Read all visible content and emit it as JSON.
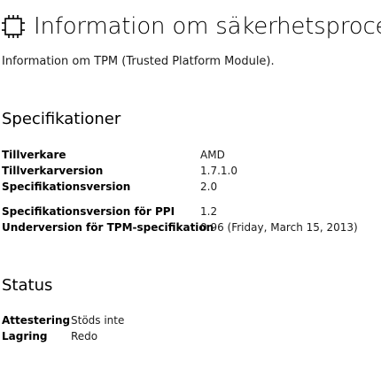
{
  "header": {
    "icon": "chip-icon",
    "title": "Information om säkerhetsprocessor"
  },
  "subtitle": "Information om TPM (Trusted Platform Module).",
  "specifications": {
    "heading": "Specifikationer",
    "rows": [
      {
        "label": "Tillverkare",
        "value": "AMD"
      },
      {
        "label": "Tillverkarversion",
        "value": "1.7.1.0"
      },
      {
        "label": "Specifikationsversion",
        "value": "2.0"
      },
      {
        "label": "Specifikationsversion för PPI",
        "value": "1.2"
      },
      {
        "label": "Underversion för TPM-specifikation",
        "value": "0.96 (Friday, March 15, 2013)"
      }
    ]
  },
  "status": {
    "heading": "Status",
    "rows": [
      {
        "label": "Attestering",
        "value": "Stöds inte"
      },
      {
        "label": "Lagring",
        "value": "Redo"
      }
    ]
  }
}
